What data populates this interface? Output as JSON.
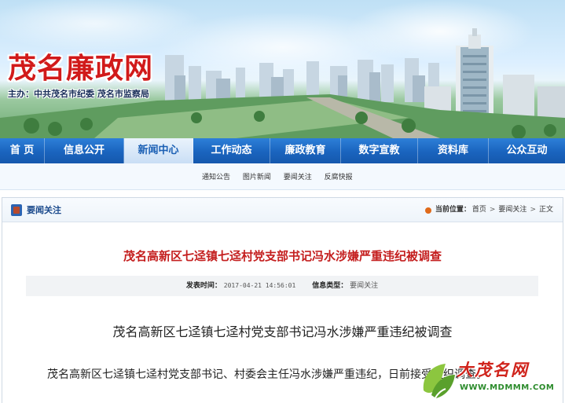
{
  "banner": {
    "site_name": "茂名廉政网",
    "sponsors": "主办：中共茂名市纪委   茂名市监察局"
  },
  "mainnav": [
    {
      "label": "首  页",
      "active": false
    },
    {
      "label": "信息公开",
      "active": false
    },
    {
      "label": "新闻中心",
      "active": true
    },
    {
      "label": "工作动态",
      "active": false
    },
    {
      "label": "廉政教育",
      "active": false
    },
    {
      "label": "数字宣教",
      "active": false
    },
    {
      "label": "资料库",
      "active": false
    },
    {
      "label": "公众互动",
      "active": false
    }
  ],
  "subnav": [
    "通知公告",
    "图片新闻",
    "要闻关注",
    "反腐快报"
  ],
  "box": {
    "title": "要闻关注",
    "breadcrumb_label": "当前位置：",
    "breadcrumb": [
      "首页",
      "要闻关注",
      "正文"
    ]
  },
  "article": {
    "title": "茂名高新区七迳镇七迳村党支部书记冯水涉嫌严重违纪被调查",
    "publish_label": "发表时间：",
    "publish_time": "2017-04-21 14:56:01",
    "type_label": "信息类型：",
    "type_value": "要闻关注",
    "subtitle": "茂名高新区七迳镇七迳村党支部书记冯水涉嫌严重违纪被调查",
    "paragraph": "茂名高新区七迳镇七迳村党支部书记、村委会主任冯水涉嫌严重违纪，日前接受组织调查。"
  },
  "watermark": {
    "text": "大茂名网",
    "url": "WWW.MDMMM.COM"
  },
  "colors": {
    "nav_blue": "#1a64be",
    "title_red": "#c41e1e",
    "logo_red": "#d11a1a"
  }
}
